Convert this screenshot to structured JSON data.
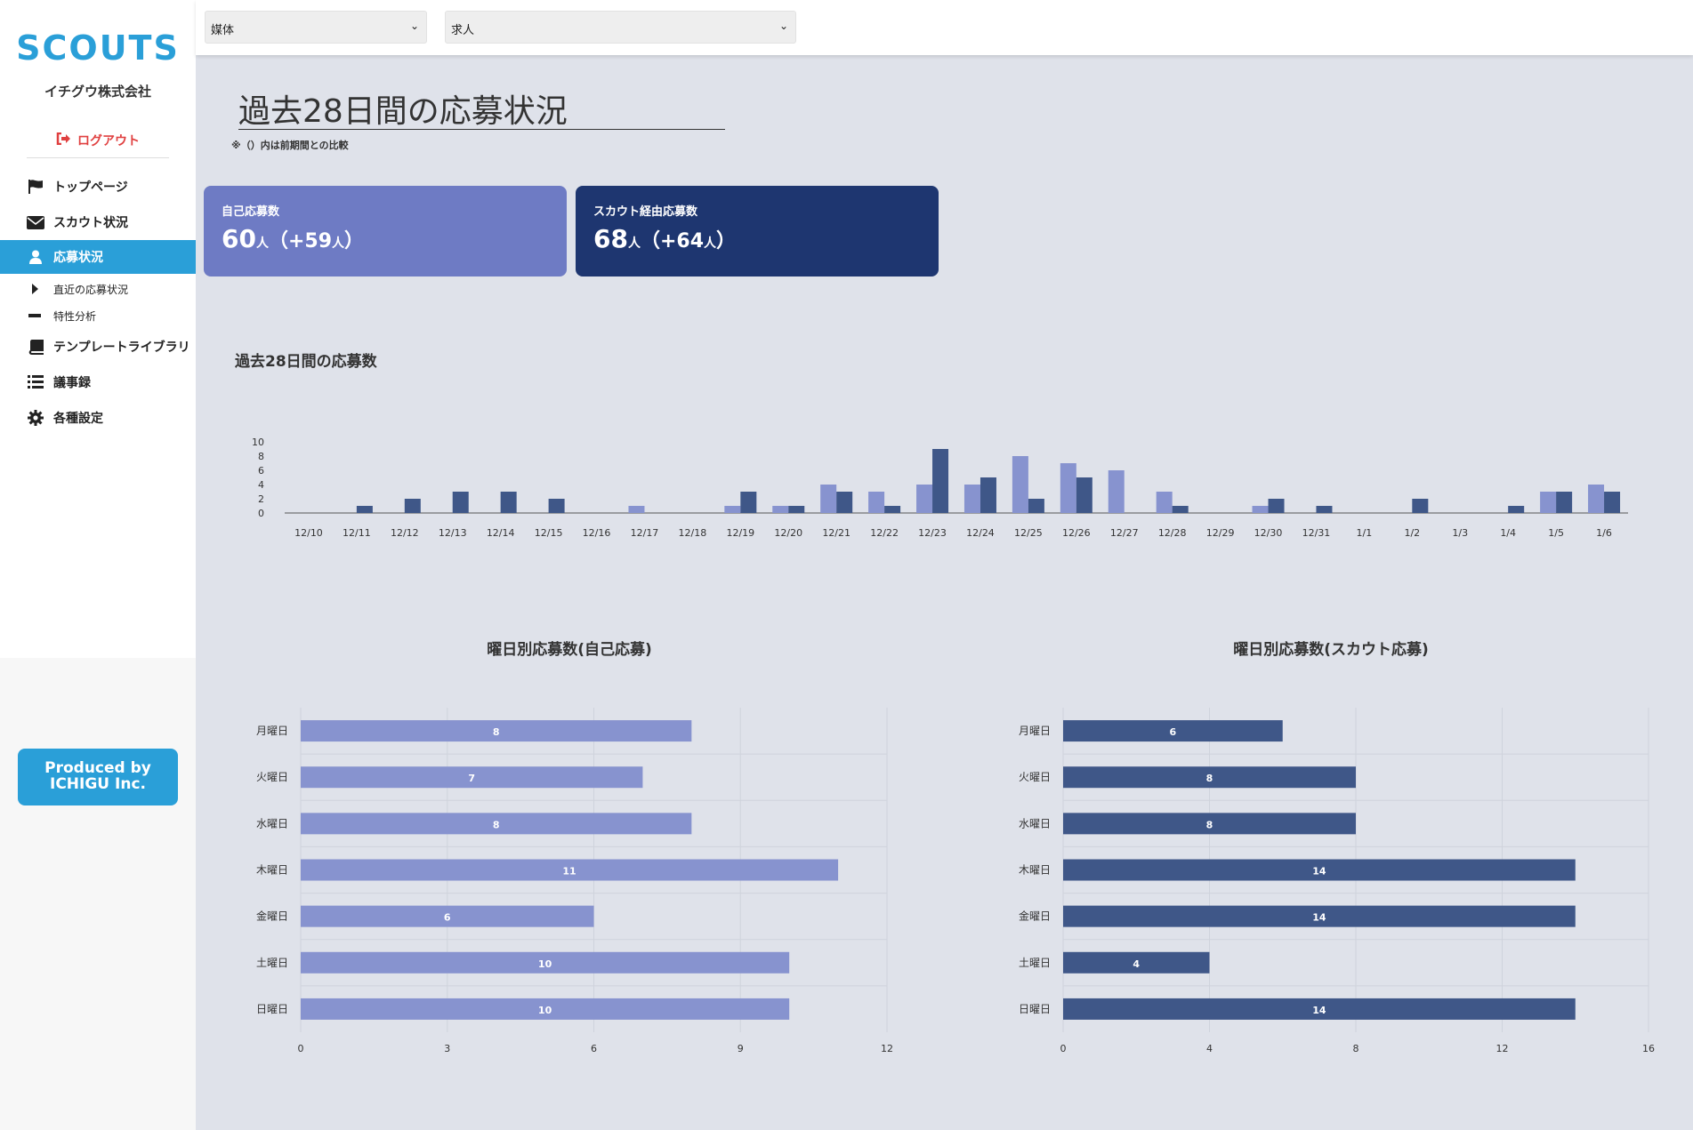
{
  "logo": "SCOUTS",
  "company": "イチグウ株式会社",
  "logout": "ログアウト",
  "menu": [
    {
      "label": "トップページ",
      "icon": "flag-icon"
    },
    {
      "label": "スカウト状況",
      "icon": "envelope-icon"
    },
    {
      "label": "応募状況",
      "icon": "user-icon"
    },
    {
      "label": "直近の応募状況",
      "icon": "caret-right-icon"
    },
    {
      "label": "特性分析",
      "icon": "dash-icon"
    },
    {
      "label": "テンプレートライブラリ",
      "icon": "book-icon"
    },
    {
      "label": "議事録",
      "icon": "list-icon"
    },
    {
      "label": "各種設定",
      "icon": "gear-icon"
    }
  ],
  "produced_by": {
    "line1": "Produced by",
    "line2": "ICHIGU Inc."
  },
  "filters": {
    "media": "媒体",
    "job": "求人"
  },
  "page_title": "過去28日間の応募状況",
  "note": "※（）内は前期間との比較",
  "cards": {
    "self": {
      "label": "自己応募数",
      "value": "60",
      "unit": "人",
      "diff_open": "（+59",
      "diff_unit": "人",
      "diff_close": "）"
    },
    "scout": {
      "label": "スカウト経由応募数",
      "value": "68",
      "unit": "人",
      "diff_open": "（+64",
      "diff_unit": "人",
      "diff_close": "）"
    }
  },
  "colors": {
    "self": "#8793cf",
    "scout": "#3f5788",
    "accent": "#2a9fd8",
    "card_self": "#6e7bc4",
    "card_scout": "#1e3670",
    "logout": "#e04040"
  },
  "chart_data": [
    {
      "type": "bar",
      "title": "過去28日間の応募数",
      "categories": [
        "12/10",
        "12/11",
        "12/12",
        "12/13",
        "12/14",
        "12/15",
        "12/16",
        "12/17",
        "12/18",
        "12/19",
        "12/20",
        "12/21",
        "12/22",
        "12/23",
        "12/24",
        "12/25",
        "12/26",
        "12/27",
        "12/28",
        "12/29",
        "12/30",
        "12/31",
        "1/1",
        "1/2",
        "1/3",
        "1/4",
        "1/5",
        "1/6"
      ],
      "series": [
        {
          "values": [
            0,
            0,
            0,
            0,
            0,
            0,
            0,
            1,
            0,
            1,
            1,
            4,
            3,
            4,
            4,
            8,
            7,
            6,
            3,
            0,
            1,
            0,
            0,
            0,
            0,
            0,
            3,
            4
          ]
        },
        {
          "values": [
            0,
            1,
            2,
            3,
            3,
            2,
            0,
            0,
            0,
            3,
            1,
            3,
            1,
            9,
            5,
            2,
            5,
            0,
            1,
            0,
            2,
            1,
            0,
            2,
            0,
            1,
            3,
            3
          ]
        }
      ],
      "yticks": [
        0,
        2,
        4,
        6,
        8,
        10
      ],
      "ylim": [
        0,
        10
      ]
    },
    {
      "type": "bar",
      "orientation": "horizontal",
      "title": "曜日別応募数(自己応募)",
      "categories": [
        "月曜日",
        "火曜日",
        "水曜日",
        "木曜日",
        "金曜日",
        "土曜日",
        "日曜日"
      ],
      "values": [
        8,
        7,
        8,
        11,
        6,
        10,
        10
      ],
      "xticks": [
        0,
        3,
        6,
        9,
        12
      ],
      "xlim": [
        0,
        12
      ]
    },
    {
      "type": "bar",
      "orientation": "horizontal",
      "title": "曜日別応募数(スカウト応募)",
      "categories": [
        "月曜日",
        "火曜日",
        "水曜日",
        "木曜日",
        "金曜日",
        "土曜日",
        "日曜日"
      ],
      "values": [
        6,
        8,
        8,
        14,
        14,
        4,
        14
      ],
      "xticks": [
        0,
        4,
        8,
        12,
        16
      ],
      "xlim": [
        0,
        16
      ]
    }
  ]
}
